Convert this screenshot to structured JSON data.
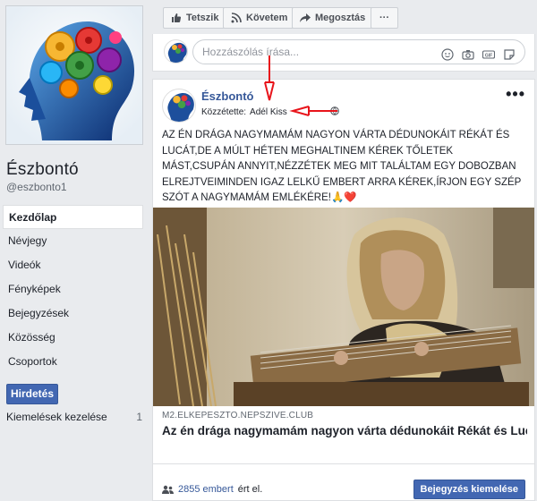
{
  "page": {
    "name": "Észbontó",
    "handle": "@eszbonto1"
  },
  "nav": {
    "items": [
      {
        "label": "Kezdőlap",
        "active": true
      },
      {
        "label": "Névjegy"
      },
      {
        "label": "Videók"
      },
      {
        "label": "Fényképek"
      },
      {
        "label": "Bejegyzések"
      },
      {
        "label": "Közösség"
      },
      {
        "label": "Csoportok"
      }
    ],
    "promote_label": "Hirdetés",
    "highlights_label": "Kiemelések kezelése",
    "highlights_count": "1"
  },
  "actions": {
    "like": "Tetszik",
    "follow": "Követem",
    "share": "Megosztás",
    "more": "···"
  },
  "comment": {
    "placeholder": "Hozzászólás írása..."
  },
  "post": {
    "author": "Észbontó",
    "posted_by_label": "Közzétette:",
    "posted_by_name": "Adél Kiss",
    "more": "•••",
    "text": "AZ ÉN DRÁGA NAGYMAMÁM NAGYON VÁRTA DÉDUNOKÁIT RÉKÁT ÉS LUCÁT,DE A MÚLT HÉTEN MEGHALTINEM KÉREK TŐLETEK MÁST,CSUPÁN ANNYIT,NÉZZÉTEK MEG MIT TALÁLTAM EGY DOBOZBAN ELREJTVEIMINDEN IGAZ LELKŰ EMBERT ARRA KÉREK,ÍRJON EGY SZÉP SZÓT A NAGYMAMÁM EMLÉKÉRE!🙏❤️",
    "link_domain": "M2.ELKEPESZTO.NEPSZIVE.CLUB",
    "link_title": "Az én drága nagymamám nagyon várta dédunokáit Rékát és Lucát,de a múlt héten meghalt!Nem kérek tőletek mást,csup…",
    "reach_count": "2855 embert",
    "reach_suffix": "ért el.",
    "boost_label": "Bejegyzés kiemelése"
  },
  "colors": {
    "fb_blue": "#4267b2",
    "link_blue": "#365899",
    "annotation_red": "#e8141b"
  }
}
